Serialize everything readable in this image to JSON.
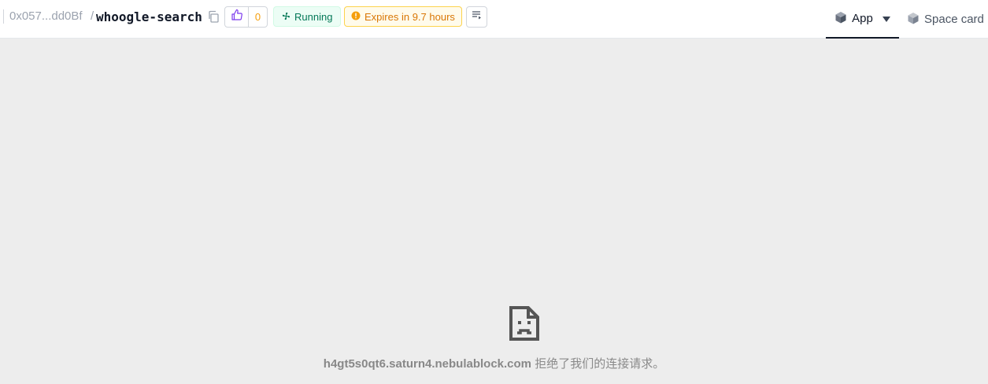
{
  "header": {
    "owner": "0x057...dd0Bf",
    "separator": "/",
    "repo": "whoogle-search",
    "likes": "0",
    "status": "Running",
    "expires": "Expires in 9.7 hours"
  },
  "tabs": {
    "app": "App",
    "space_card": "Space card"
  },
  "error": {
    "host": "h4gt5s0qt6.saturn4.nebulablock.com",
    "message": " 拒绝了我们的连接请求。"
  },
  "icons": [
    "copy-icon",
    "thumbs-up-icon",
    "fan-icon",
    "alert-circle-icon",
    "logs-icon",
    "cube-icon",
    "caret-down-icon",
    "broken-page-icon"
  ],
  "colors": {
    "running": "#047857",
    "expires": "#d97706",
    "like_count": "#f59e0b",
    "like_icon": "#7c3aed"
  }
}
